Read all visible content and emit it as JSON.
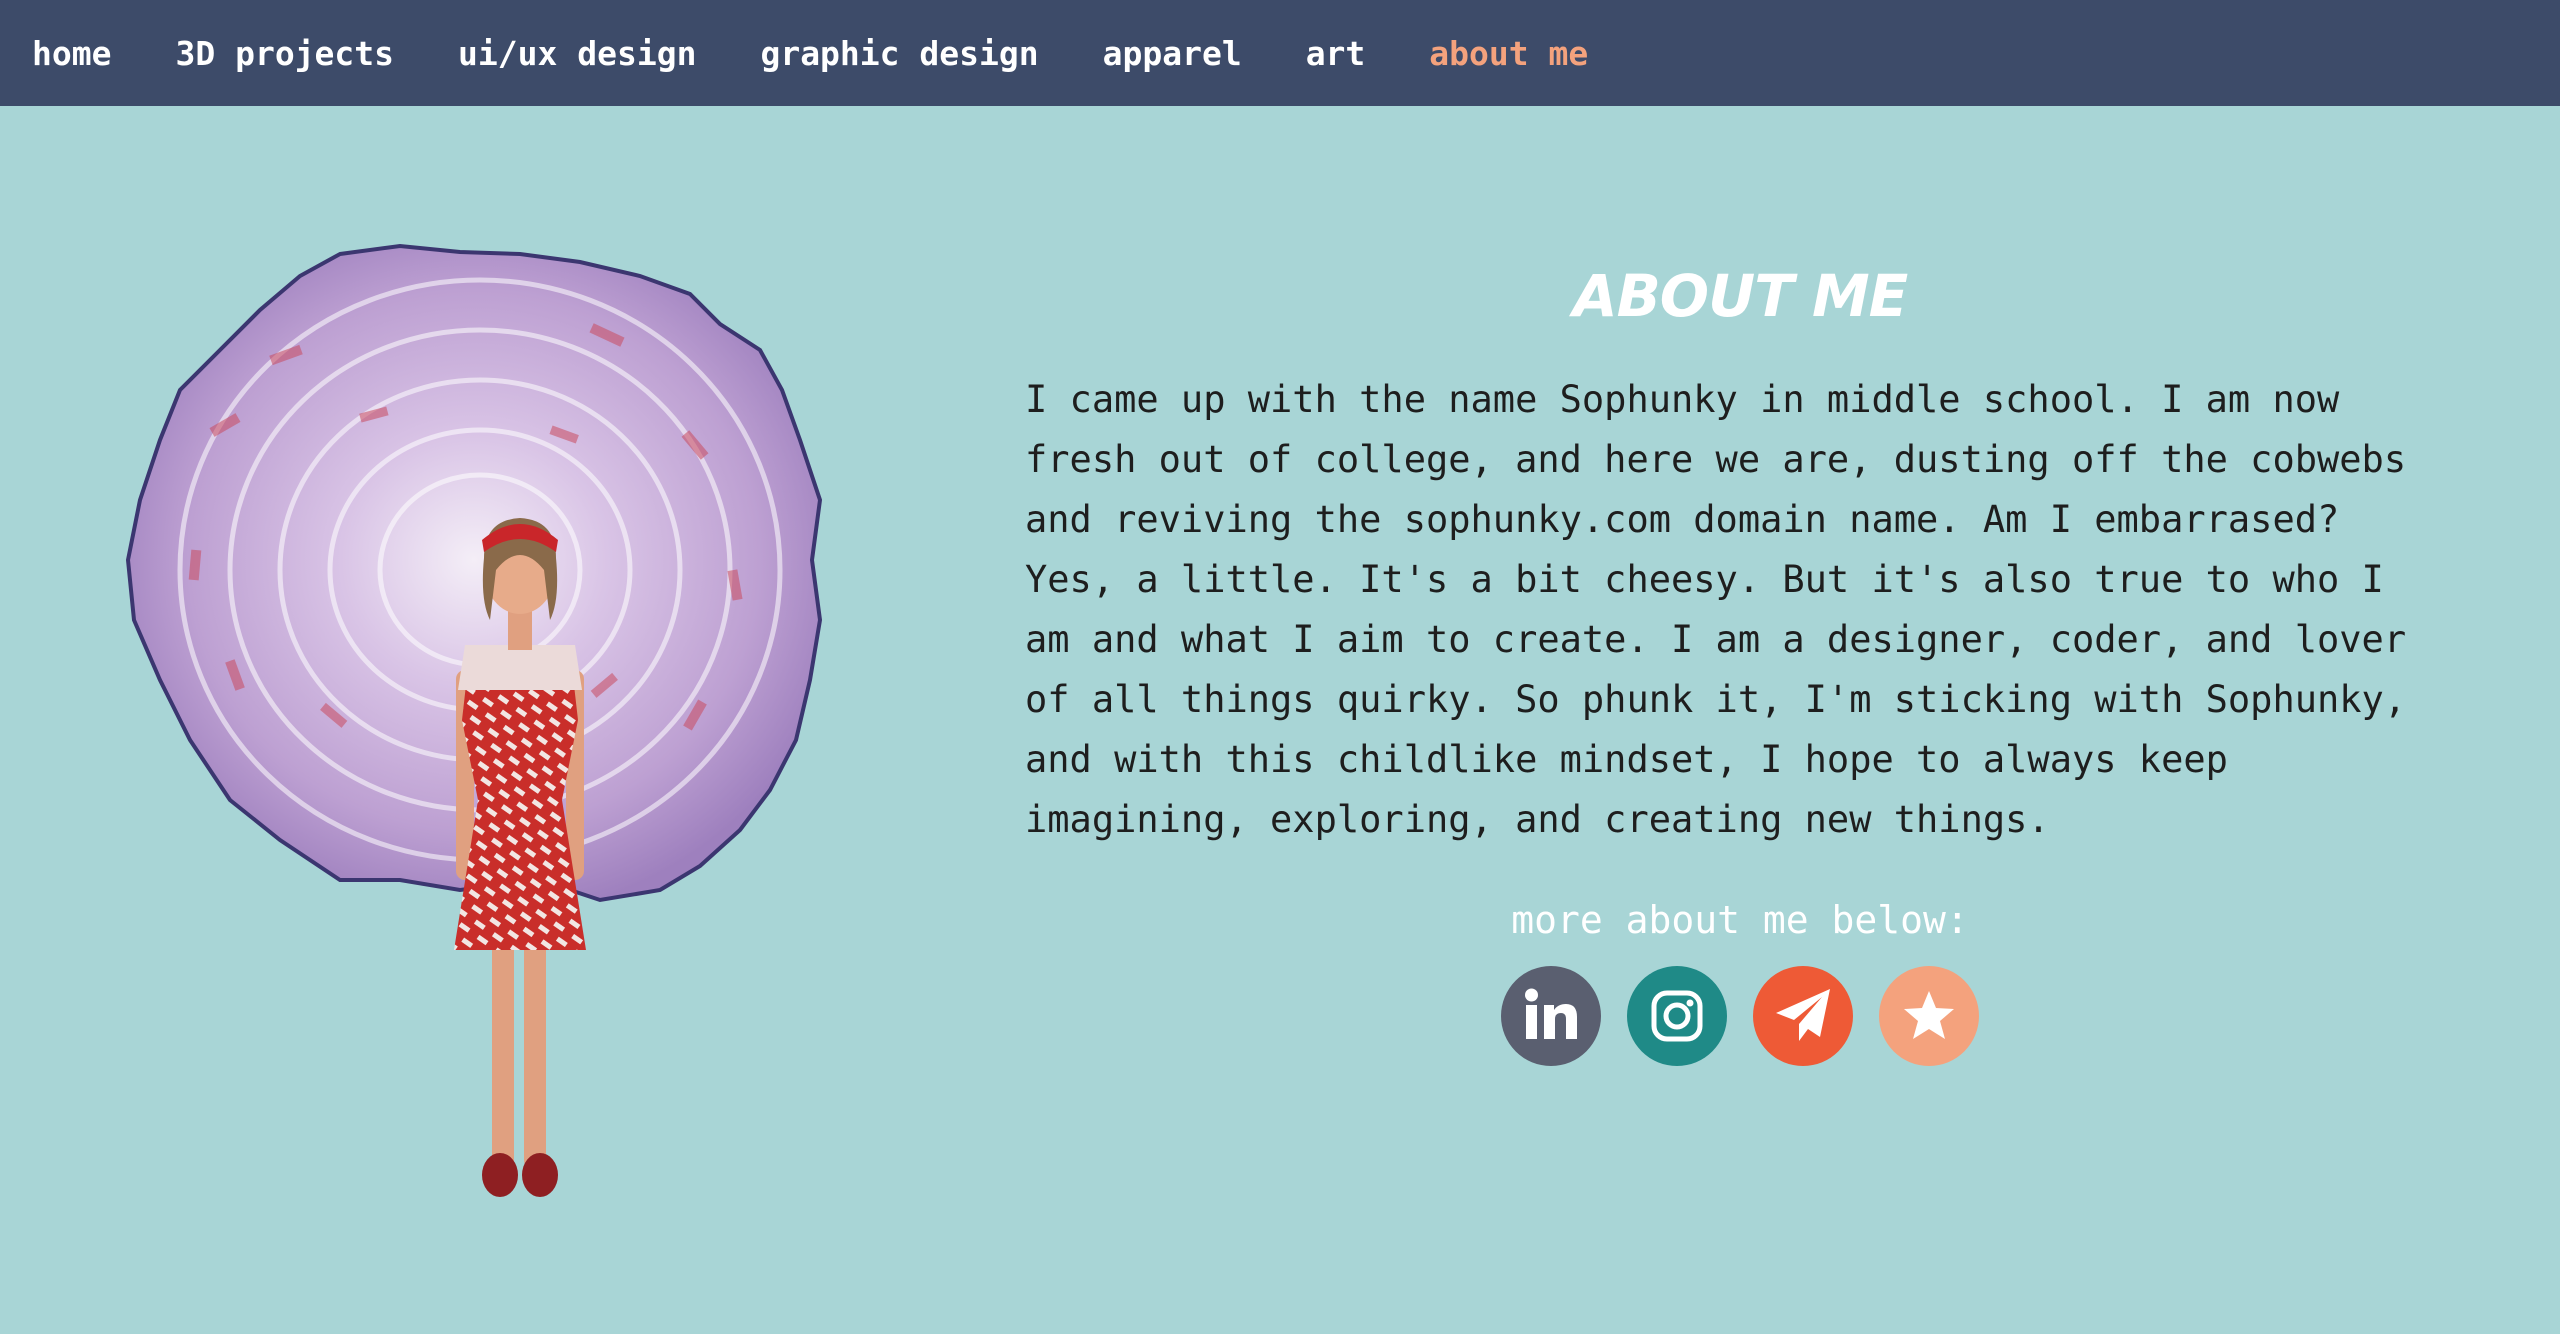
{
  "nav": {
    "items": [
      {
        "label": "home"
      },
      {
        "label": "3D projects"
      },
      {
        "label": "ui/ux design"
      },
      {
        "label": "graphic design"
      },
      {
        "label": "apparel"
      },
      {
        "label": "art"
      },
      {
        "label": "about me",
        "active": true
      }
    ]
  },
  "about": {
    "title": "ABOUT ME",
    "bio": "I came up with the name Sophunky in middle school. I am now fresh out of college, and here we are, dusting off the cobwebs and reviving the sophunky.com domain name. Am I embarrased? Yes, a little. It's a bit cheesy. But it's also true to who I am and what I aim to create. I am a designer, coder, and lover of all things quirky. So phunk it, I'm sticking with Sophunky, and with this childlike mindset, I hope to always keep imagining, exploring, and creating new things.",
    "more_label": "more about me below:"
  },
  "socials": [
    {
      "icon": "linkedin-icon",
      "color": "#5a5f70"
    },
    {
      "icon": "instagram-icon",
      "color": "#1f8a87"
    },
    {
      "icon": "paper-plane-icon",
      "color": "#ee5a36"
    },
    {
      "icon": "star-icon",
      "color": "#f4a27d"
    }
  ],
  "colors": {
    "nav_bg": "#3d4b69",
    "page_bg": "#a8d5d6",
    "accent": "#f4a27d"
  }
}
